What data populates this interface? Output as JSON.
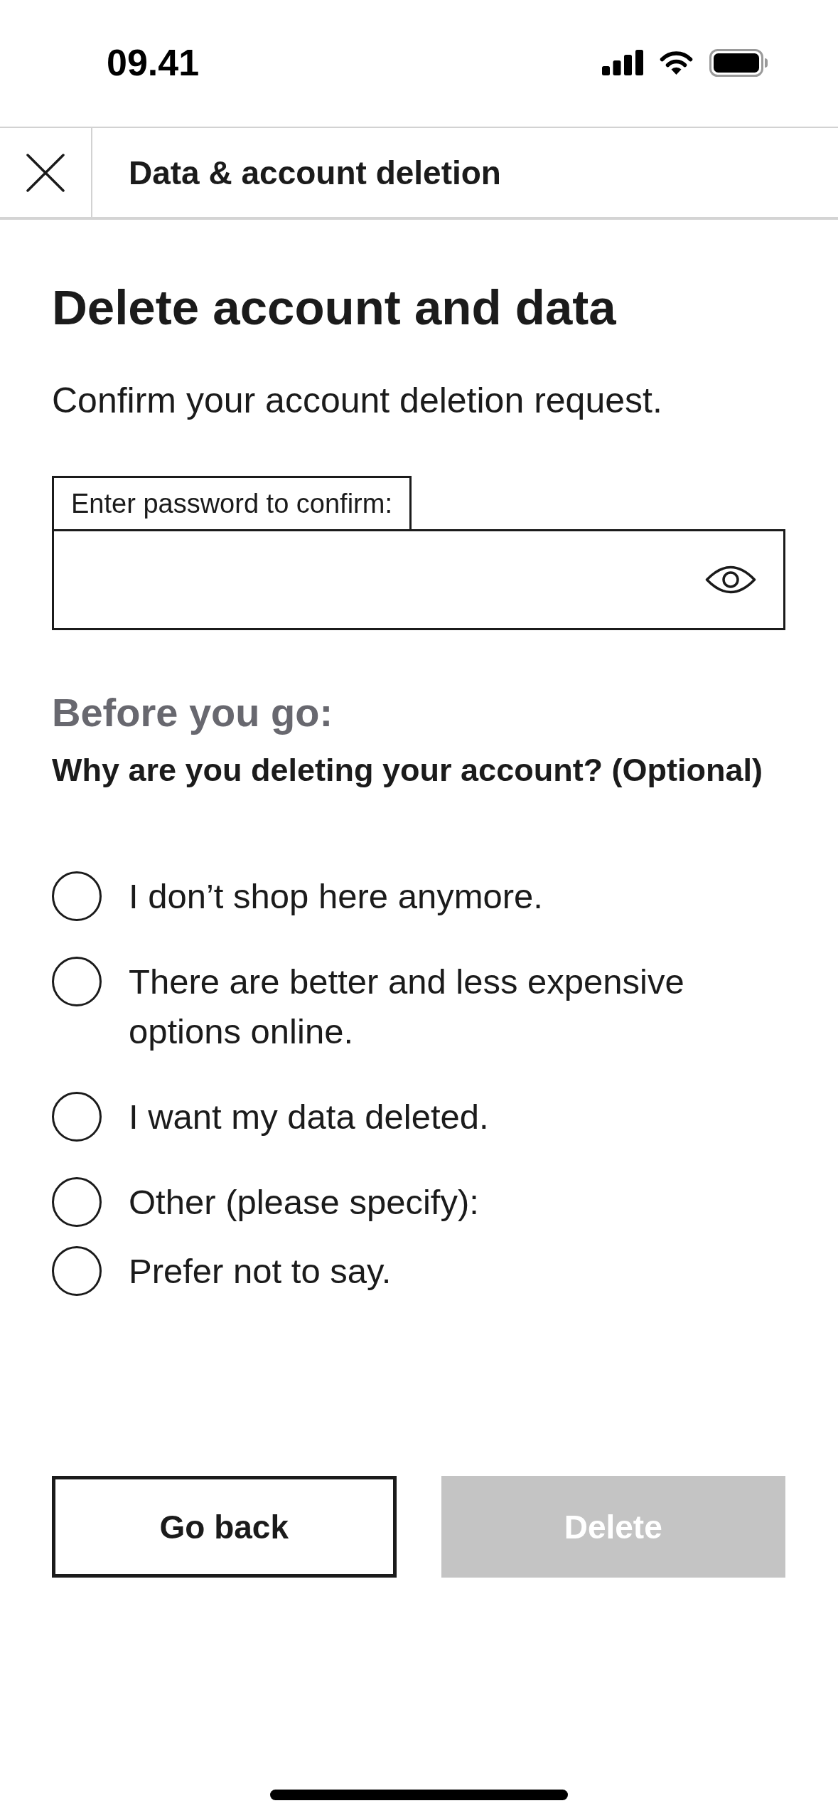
{
  "status_bar": {
    "time": "09.41"
  },
  "header": {
    "title": "Data & account deletion"
  },
  "page": {
    "title": "Delete account and data",
    "subtitle": "Confirm your account deletion request."
  },
  "password_field": {
    "label": "Enter password to confirm:"
  },
  "reasons": {
    "heading": "Before you go:",
    "question": "Why are you deleting your account? (Optional)",
    "options": [
      {
        "label": "I don’t shop here anymore.",
        "selected": false
      },
      {
        "label": "There are better and less expensive options online.",
        "selected": false
      },
      {
        "label": "I want my data deleted.",
        "selected": false
      },
      {
        "label": "Other (please specify):",
        "selected": false
      },
      {
        "label": "Prefer not to say.",
        "selected": false
      }
    ]
  },
  "buttons": [
    {
      "label": "Go back",
      "kind": "secondary",
      "disabled": false
    },
    {
      "label": "Delete",
      "kind": "primary",
      "disabled": true
    }
  ]
}
